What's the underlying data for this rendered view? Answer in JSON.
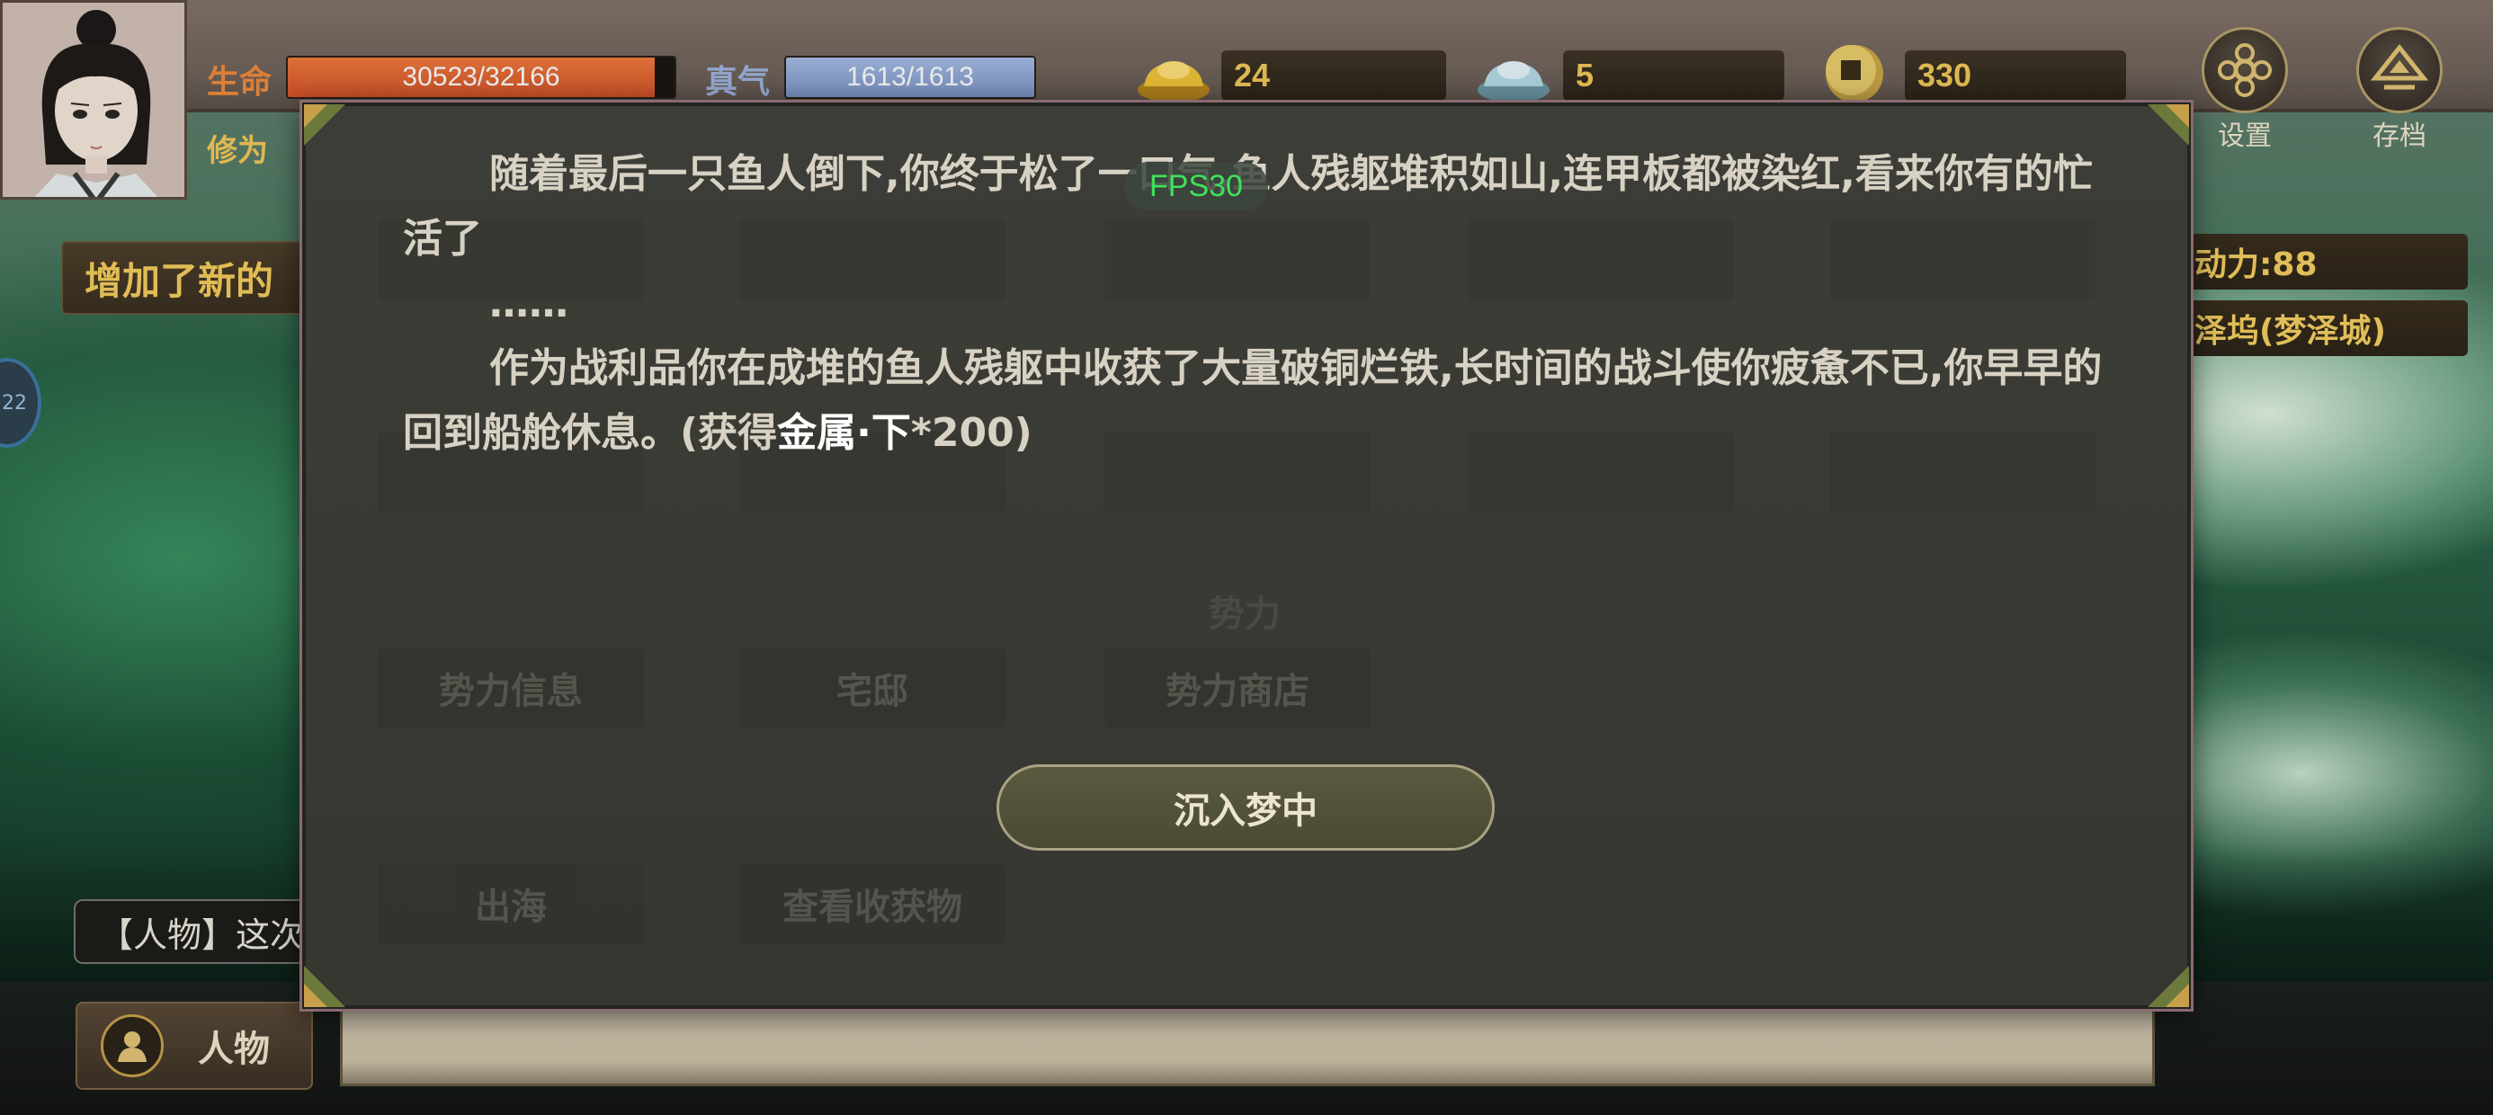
{
  "status": {
    "hp_label": "生命",
    "hp_value": "30523/32166",
    "hp_fraction": 0.949,
    "qi_label": "真气",
    "qi_value": "1613/1613",
    "qi_fraction": 1.0,
    "cultivation_label": "修为"
  },
  "currency": {
    "gold": "24",
    "silver": "5",
    "coins": "330"
  },
  "top_buttons": {
    "settings": "设置",
    "save": "存档"
  },
  "side": {
    "notice": "增加了新的",
    "orb": "22",
    "action_points": "动力:88",
    "location": "泽坞(梦泽城)",
    "chat_preview": "【人物】这次"
  },
  "bottom": {
    "character_button": "人物"
  },
  "dialog": {
    "paragraph1": "随着最后一只鱼人倒下,你终于松了一口气,鱼人残躯堆积如山,连甲板都被染红,看来你有的忙活了",
    "ellipsis": "……",
    "paragraph2_before": "作为战利品你在成堆的鱼人残躯中收获了大量破铜烂铁,长时间的战斗使你疲惫不已,你早早的回到船舱休息。(获得",
    "paragraph2_item": "金属·下",
    "paragraph2_after": "*200)",
    "confirm_button": "沉入梦中"
  },
  "background_menu": {
    "heading": "势力",
    "row3": [
      "势力信息",
      "宅邸",
      "势力商店"
    ],
    "row4": [
      "出海",
      "查看收获物"
    ]
  },
  "fps": "FPS30",
  "colors": {
    "hp_bar": "#e5622e",
    "qi_bar": "#8fa7d4",
    "gold_text": "#f1c85a",
    "accent_gold": "#c8a04c"
  }
}
